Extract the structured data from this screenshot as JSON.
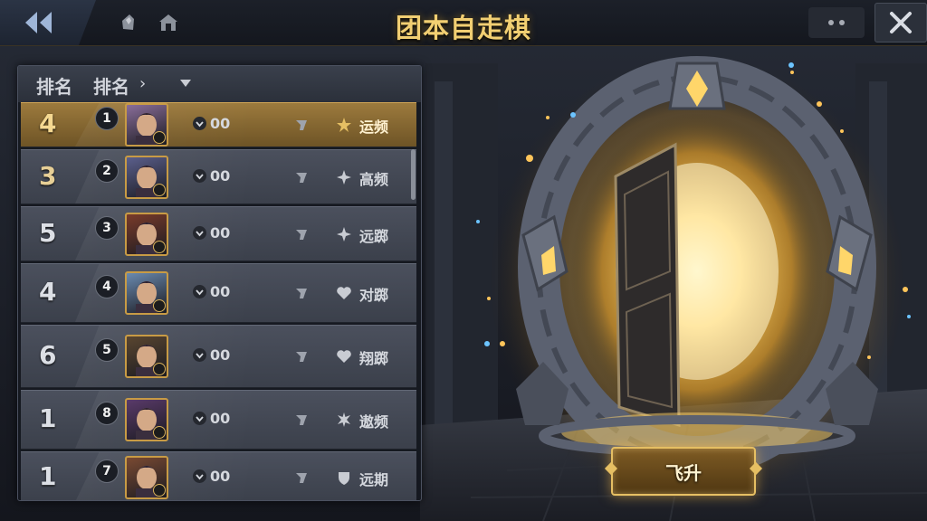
{
  "header": {
    "title": "团本自走棋",
    "back_icon": "double-chevron-left-icon",
    "icons": [
      "gem-icon",
      "house-icon"
    ],
    "more_icon": "more-dots-icon",
    "close_icon": "close-icon"
  },
  "panel": {
    "header_rank_a": "排名",
    "header_rank_b": "排名",
    "header_chevron": "›",
    "sort_icon": "dropdown-triangle-icon",
    "rows": [
      {
        "rank": "4",
        "position": "1",
        "score": "00",
        "trait": "运频",
        "trait_icon": "star-icon",
        "selected": true
      },
      {
        "rank": "3",
        "position": "2",
        "score": "00",
        "trait": "高频",
        "trait_icon": "sparkle-icon",
        "selected": false
      },
      {
        "rank": "5",
        "position": "3",
        "score": "00",
        "trait": "远踯",
        "trait_icon": "sparkle-icon",
        "selected": false
      },
      {
        "rank": "4",
        "position": "4",
        "score": "00",
        "trait": "对踯",
        "trait_icon": "heart-icon",
        "selected": false
      },
      {
        "rank": "6",
        "position": "5",
        "score": "00",
        "trait": "翔踯",
        "trait_icon": "heart-icon",
        "selected": false
      },
      {
        "rank": "1",
        "position": "8",
        "score": "00",
        "trait": "遨频",
        "trait_icon": "spiky-star-icon",
        "selected": false
      },
      {
        "rank": "1",
        "position": "7",
        "score": "00",
        "trait": "远期",
        "trait_icon": "shield-icon",
        "selected": false
      }
    ]
  },
  "action": {
    "ascend_label": "飞升"
  },
  "colors": {
    "accent_gold": "#f2cf72",
    "selected_row": "#9c7a3d",
    "portal_glow": "#ffd36a"
  }
}
